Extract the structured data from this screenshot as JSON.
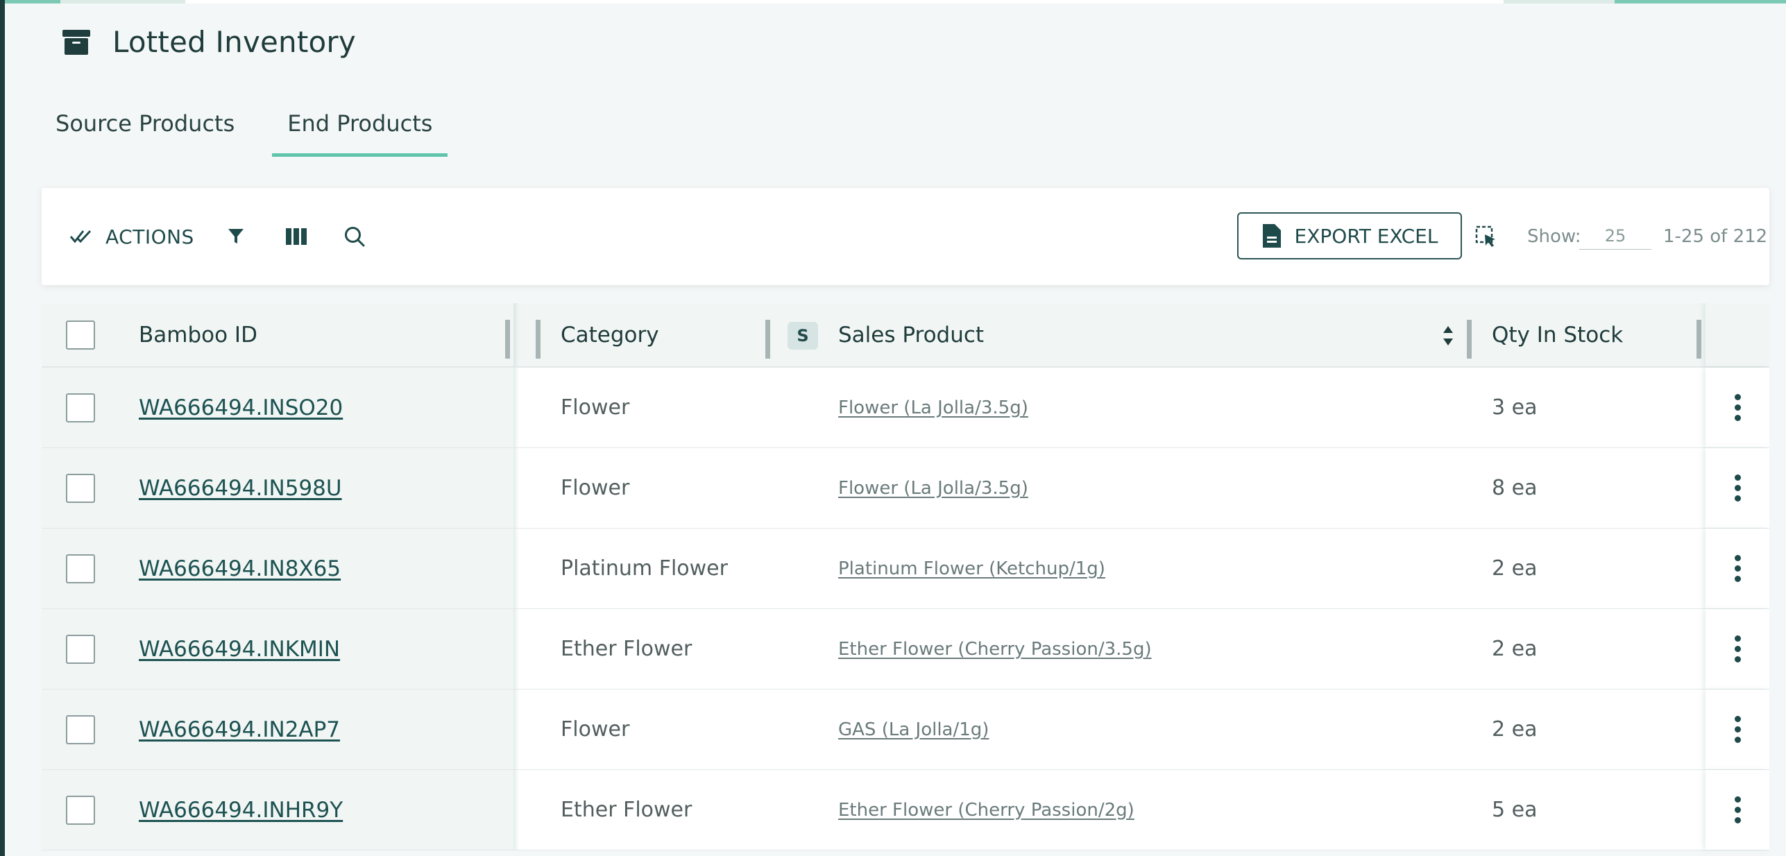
{
  "page": {
    "title": "Lotted Inventory"
  },
  "tabs": [
    {
      "label": "Source Products",
      "active": false
    },
    {
      "label": "End Products",
      "active": true
    }
  ],
  "toolbar": {
    "actions_label": "ACTIONS",
    "export_label": "EXPORT EXCEL",
    "show_label": "Show:",
    "show_value": "25",
    "range_text": "1-25 of 212"
  },
  "table": {
    "headers": {
      "bamboo_id": "Bamboo ID",
      "category": "Category",
      "sales_product": "Sales Product",
      "qty": "Qty In Stock",
      "sales_icon": "S"
    },
    "rows": [
      {
        "id": "WA666494.INSO20",
        "category": "Flower",
        "product": "Flower (La Jolla/3.5g)",
        "qty": "3 ea"
      },
      {
        "id": "WA666494.IN598U",
        "category": "Flower",
        "product": "Flower (La Jolla/3.5g)",
        "qty": "8 ea"
      },
      {
        "id": "WA666494.IN8X65",
        "category": "Platinum Flower",
        "product": "Platinum Flower (Ketchup/1g)",
        "qty": "2 ea"
      },
      {
        "id": "WA666494.INKMIN",
        "category": "Ether Flower",
        "product": "Ether Flower (Cherry Passion/3.5g)",
        "qty": "2 ea"
      },
      {
        "id": "WA666494.IN2AP7",
        "category": "Flower",
        "product": "GAS (La Jolla/1g)",
        "qty": "2 ea"
      },
      {
        "id": "WA666494.INHR9Y",
        "category": "Ether Flower",
        "product": "Ether Flower (Cherry Passion/2g)",
        "qty": "5 ea"
      }
    ]
  },
  "icons": {
    "header": "archive-box-icon",
    "actions": "double-check-icon",
    "filter": "filter-icon",
    "columns": "columns-icon",
    "search": "search-icon",
    "export": "document-icon",
    "select": "selection-cursor-icon",
    "row_menu": "kebab-menu-icon",
    "sort": "sort-icon"
  },
  "colors": {
    "accent": "#5fc4ac",
    "primary": "#1f4a4a",
    "rail": "#1f3d3d"
  }
}
